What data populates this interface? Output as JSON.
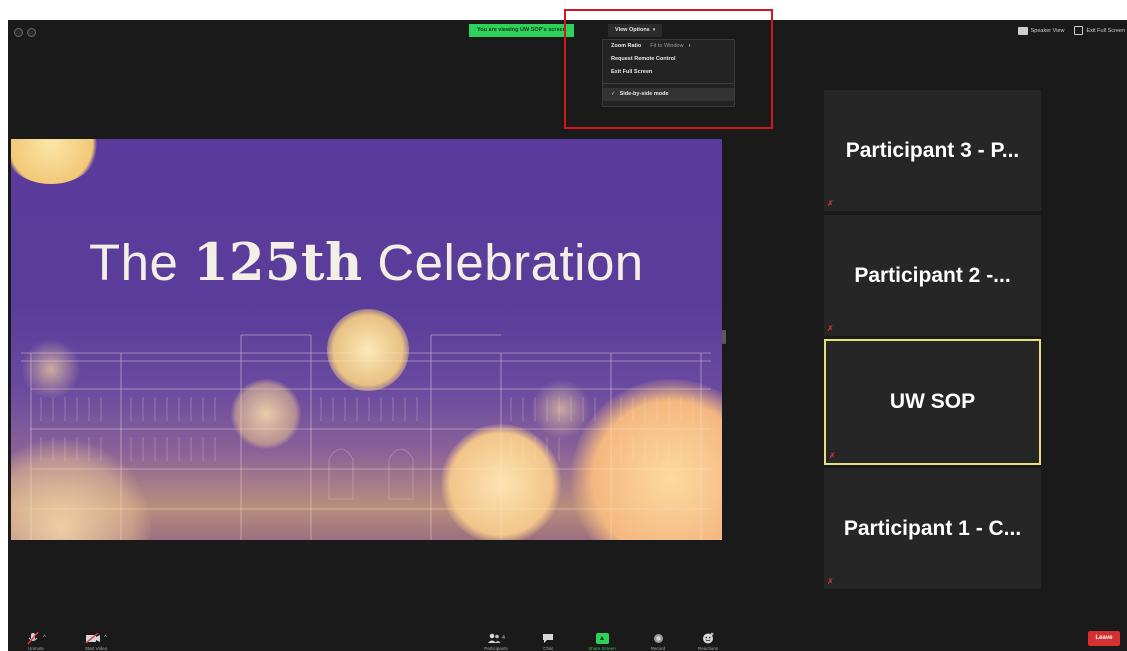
{
  "top_bar": {
    "viewing_banner": "You are viewing UW SOP's screen",
    "view_options": {
      "label": "View Options",
      "caret": "▾",
      "menu": {
        "zoom_ratio_label": "Zoom Ratio",
        "zoom_ratio_value": "Fit to Window",
        "request_remote_control": "Request Remote Control",
        "exit_full_screen": "Exit Full Screen",
        "side_by_side_mode": "Side-by-side mode"
      }
    },
    "speaker_view": "Speaker View",
    "exit_full_screen": "Exit Full Screen"
  },
  "shared_screen": {
    "title_prefix": "The ",
    "title_bold": "125th",
    "title_suffix": " Celebration"
  },
  "participants": [
    {
      "name": "Participant 3 - P...",
      "muted_icon": "✗",
      "active": false
    },
    {
      "name": "Participant 2 -...",
      "muted_icon": "✗",
      "active": false
    },
    {
      "name": "UW SOP",
      "muted_icon": "✗",
      "active": true
    },
    {
      "name": "Participant 1 - C...",
      "muted_icon": "✗",
      "active": false
    }
  ],
  "toolbar": {
    "unmute": "Unmute",
    "start_video": "Start Video",
    "participants": "Participants",
    "participants_count": "4",
    "chat": "Chat",
    "share_screen": "Share Screen",
    "record": "Record",
    "reactions": "Reactions",
    "leave": "Leave"
  },
  "colors": {
    "accent_green": "#2ed15a",
    "highlight_red": "#d3171c",
    "active_speaker": "#e5e07a",
    "leave_red": "#d63131"
  }
}
